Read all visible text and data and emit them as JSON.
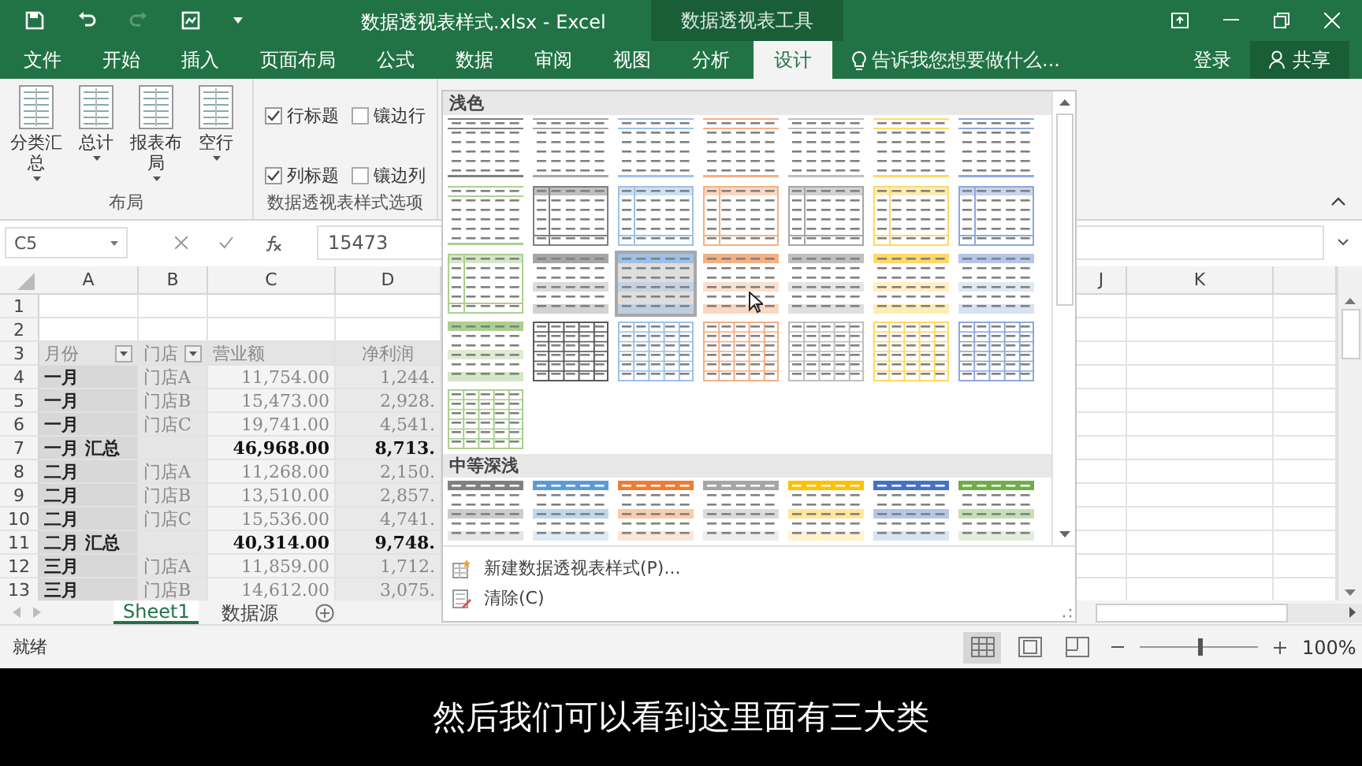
{
  "window": {
    "title": "数据透视表样式.xlsx - Excel",
    "context_tab_group": "数据透视表工具"
  },
  "menu_tabs": [
    {
      "label": "文件",
      "selected": false
    },
    {
      "label": "开始",
      "selected": false
    },
    {
      "label": "插入",
      "selected": false
    },
    {
      "label": "页面布局",
      "selected": false
    },
    {
      "label": "公式",
      "selected": false
    },
    {
      "label": "数据",
      "selected": false
    },
    {
      "label": "审阅",
      "selected": false
    },
    {
      "label": "视图",
      "selected": false
    },
    {
      "label": "分析",
      "selected": false
    },
    {
      "label": "设计",
      "selected": true
    }
  ],
  "tell_me": {
    "placeholder": "告诉我您想要做什么..."
  },
  "sign_in": "登录",
  "share": "共享",
  "ribbon": {
    "layout_group": {
      "label": "布局",
      "buttons": [
        "分类汇总",
        "总计",
        "报表布局",
        "空行"
      ]
    },
    "options_group": {
      "label": "数据透视表样式选项",
      "checkboxes": [
        {
          "label": "行标题",
          "checked": true
        },
        {
          "label": "镶边行",
          "checked": false
        },
        {
          "label": "列标题",
          "checked": true
        },
        {
          "label": "镶边列",
          "checked": false
        }
      ]
    }
  },
  "gallery": {
    "sections": [
      {
        "title": "浅色",
        "styles": [
          {
            "kind": "lines",
            "color": "#7f7f7f",
            "selected": false
          },
          {
            "kind": "lines",
            "color": "#a6a6a6",
            "selected": false
          },
          {
            "kind": "lines",
            "color": "#9bc2e6",
            "selected": false
          },
          {
            "kind": "lines",
            "color": "#f4b084",
            "selected": false
          },
          {
            "kind": "lines",
            "color": "#bfbfbf",
            "selected": false
          },
          {
            "kind": "lines",
            "color": "#ffd966",
            "selected": false
          },
          {
            "kind": "lines",
            "color": "#8ea9db",
            "selected": false
          },
          {
            "kind": "lines",
            "color": "#a9d08e",
            "selected": false
          },
          {
            "kind": "framed",
            "color": "#808080",
            "selected": false
          },
          {
            "kind": "framed",
            "color": "#9bc2e6",
            "selected": false
          },
          {
            "kind": "framed",
            "color": "#f4b084",
            "selected": false
          },
          {
            "kind": "framed",
            "color": "#a6a6a6",
            "selected": false
          },
          {
            "kind": "framed",
            "color": "#ffd966",
            "selected": false
          },
          {
            "kind": "framed",
            "color": "#8ea9db",
            "selected": false
          },
          {
            "kind": "framed",
            "color": "#a9d08e",
            "selected": false
          },
          {
            "kind": "banded",
            "color": "#a6a6a6",
            "selected": false
          },
          {
            "kind": "banded",
            "color": "#9bc2e6",
            "selected": true
          },
          {
            "kind": "banded",
            "color": "#f4b084",
            "selected": false
          },
          {
            "kind": "banded",
            "color": "#bfbfbf",
            "selected": false
          },
          {
            "kind": "banded",
            "color": "#ffd966",
            "selected": false
          },
          {
            "kind": "banded",
            "color": "#b4c6e7",
            "selected": false
          },
          {
            "kind": "banded",
            "color": "#a9d08e",
            "selected": false
          },
          {
            "kind": "grid",
            "color": "#595959",
            "selected": false
          },
          {
            "kind": "grid",
            "color": "#9bc2e6",
            "selected": false
          },
          {
            "kind": "grid",
            "color": "#f4b084",
            "selected": false
          },
          {
            "kind": "grid",
            "color": "#bfbfbf",
            "selected": false
          },
          {
            "kind": "grid",
            "color": "#ffd966",
            "selected": false
          },
          {
            "kind": "grid",
            "color": "#8ea9db",
            "selected": false
          },
          {
            "kind": "grid",
            "color": "#a9d08e",
            "selected": false
          }
        ]
      },
      {
        "title": "中等深浅",
        "styles": [
          {
            "kind": "medium",
            "color": "#808080",
            "selected": false
          },
          {
            "kind": "medium",
            "color": "#5b9bd5",
            "selected": false
          },
          {
            "kind": "medium",
            "color": "#ed7d31",
            "selected": false
          },
          {
            "kind": "medium",
            "color": "#a5a5a5",
            "selected": false
          },
          {
            "kind": "medium",
            "color": "#ffc000",
            "selected": false
          },
          {
            "kind": "medium",
            "color": "#4472c4",
            "selected": false
          },
          {
            "kind": "medium",
            "color": "#70ad47",
            "selected": false
          }
        ]
      }
    ],
    "menu_items": [
      "新建数据透视表样式(P)...",
      "清除(C)"
    ]
  },
  "formula_bar": {
    "name_box": "C5",
    "value": "15473"
  },
  "sheet": {
    "columns": [
      "A",
      "B",
      "C",
      "D",
      "J",
      "K"
    ],
    "rows": [
      {
        "number": "1",
        "kind": "blank",
        "cells": []
      },
      {
        "number": "2",
        "kind": "blank",
        "cells": []
      },
      {
        "number": "3",
        "kind": "header",
        "cells": [
          {
            "text": "月份",
            "filter": true
          },
          {
            "text": "门店",
            "filter": true
          },
          {
            "text": "营业额",
            "filter": false
          },
          {
            "text": "净利润",
            "filter": false
          }
        ]
      },
      {
        "number": "4",
        "kind": "detail",
        "cells": [
          {
            "text": "一月"
          },
          {
            "text": "门店A"
          },
          {
            "text": "11,754.00"
          },
          {
            "text": "1,244."
          }
        ]
      },
      {
        "number": "5",
        "kind": "detail",
        "cells": [
          {
            "text": "一月"
          },
          {
            "text": "门店B"
          },
          {
            "text": "15,473.00"
          },
          {
            "text": "2,928."
          }
        ]
      },
      {
        "number": "6",
        "kind": "detail",
        "cells": [
          {
            "text": "一月"
          },
          {
            "text": "门店C"
          },
          {
            "text": "19,741.00"
          },
          {
            "text": "4,541."
          }
        ]
      },
      {
        "number": "7",
        "kind": "subtotal",
        "cells": [
          {
            "text": "一月 汇总"
          },
          {
            "text": ""
          },
          {
            "text": "46,968.00"
          },
          {
            "text": "8,713."
          }
        ]
      },
      {
        "number": "8",
        "kind": "detail",
        "cells": [
          {
            "text": "二月"
          },
          {
            "text": "门店A"
          },
          {
            "text": "11,268.00"
          },
          {
            "text": "2,150."
          }
        ]
      },
      {
        "number": "9",
        "kind": "detail",
        "cells": [
          {
            "text": "二月"
          },
          {
            "text": "门店B"
          },
          {
            "text": "13,510.00"
          },
          {
            "text": "2,857."
          }
        ]
      },
      {
        "number": "10",
        "kind": "detail",
        "cells": [
          {
            "text": "二月"
          },
          {
            "text": "门店C"
          },
          {
            "text": "15,536.00"
          },
          {
            "text": "4,741."
          }
        ]
      },
      {
        "number": "11",
        "kind": "subtotal",
        "cells": [
          {
            "text": "二月 汇总"
          },
          {
            "text": ""
          },
          {
            "text": "40,314.00"
          },
          {
            "text": "9,748."
          }
        ]
      },
      {
        "number": "12",
        "kind": "detail",
        "cells": [
          {
            "text": "三月"
          },
          {
            "text": "门店A"
          },
          {
            "text": "11,859.00"
          },
          {
            "text": "1,712."
          }
        ]
      },
      {
        "number": "13",
        "kind": "detail",
        "cells": [
          {
            "text": "三月"
          },
          {
            "text": "门店B"
          },
          {
            "text": "14,612.00"
          },
          {
            "text": "3,075."
          }
        ]
      }
    ],
    "tabs": [
      {
        "label": "Sheet1",
        "selected": true
      },
      {
        "label": "数据源",
        "selected": false
      }
    ]
  },
  "status_bar": {
    "status": "就绪",
    "views": [
      {
        "kind": "normal",
        "selected": true
      },
      {
        "kind": "page_layout",
        "selected": false
      },
      {
        "kind": "page_break",
        "selected": false
      }
    ],
    "zoom": {
      "level": 0.5,
      "reading": "100%"
    }
  },
  "caption": "然后我们可以看到这里面有三大类"
}
